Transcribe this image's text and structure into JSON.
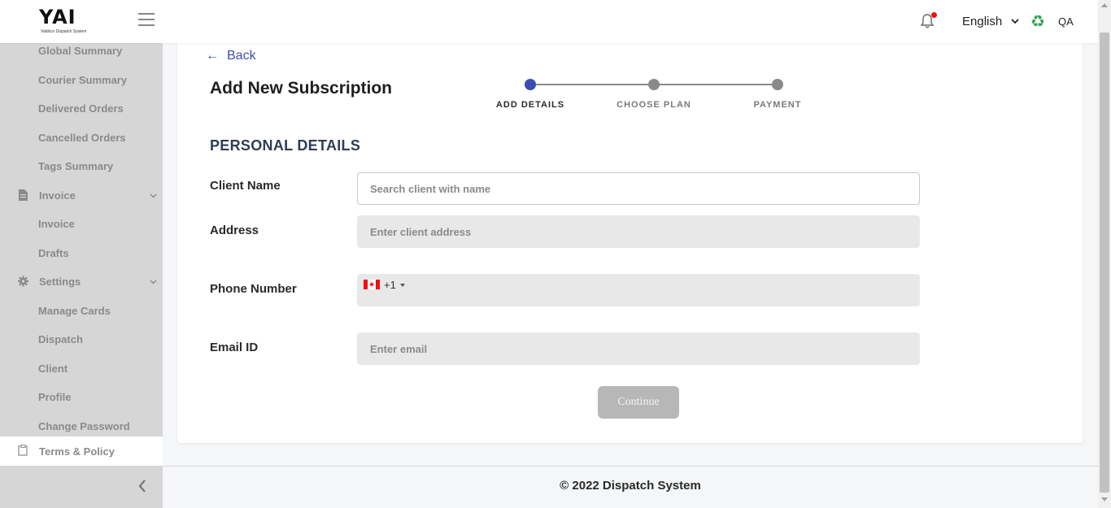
{
  "header": {
    "logo_text": "YAI",
    "logo_subtitle": "Valdicsr Dispatch System",
    "language": "English",
    "user": "QA",
    "recycle_glyph": "♻"
  },
  "sidebar": {
    "items": [
      {
        "label": "Global Summary"
      },
      {
        "label": "Courier Summary"
      },
      {
        "label": "Delivered Orders"
      },
      {
        "label": "Cancelled Orders"
      },
      {
        "label": "Tags Summary"
      },
      {
        "label": "Invoice",
        "icon": "document-icon",
        "expandable": true
      },
      {
        "label": "Invoice"
      },
      {
        "label": "Drafts"
      },
      {
        "label": "Settings",
        "icon": "gear-icon",
        "expandable": true
      },
      {
        "label": "Manage Cards"
      },
      {
        "label": "Dispatch"
      },
      {
        "label": "Client"
      },
      {
        "label": "Profile"
      },
      {
        "label": "Change Password"
      },
      {
        "label": "Terms & Policy",
        "icon": "clipboard-icon",
        "active": true
      }
    ]
  },
  "main": {
    "back_label": "Back",
    "back_arrow": "←",
    "title": "Add New Subscription",
    "steps": [
      {
        "label": "ADD DETAILS",
        "active": true
      },
      {
        "label": "CHOOSE PLAN",
        "active": false
      },
      {
        "label": "PAYMENT",
        "active": false
      }
    ],
    "section_title": "PERSONAL DETAILS",
    "fields": {
      "client_name": {
        "label": "Client Name",
        "placeholder": "Search client with name"
      },
      "address": {
        "label": "Address",
        "placeholder": "Enter client address"
      },
      "phone": {
        "label": "Phone Number",
        "country_code": "+1",
        "country": "Canada"
      },
      "email": {
        "label": "Email ID",
        "placeholder": "Enter email"
      }
    },
    "continue_label": "Continue"
  },
  "footer": {
    "text": "© 2022 Dispatch System"
  },
  "colors": {
    "accent": "#3b4eb0",
    "sidebar_bg": "#d6d6d6",
    "notification_dot": "#ee1111",
    "recycle": "#2ea44f"
  }
}
